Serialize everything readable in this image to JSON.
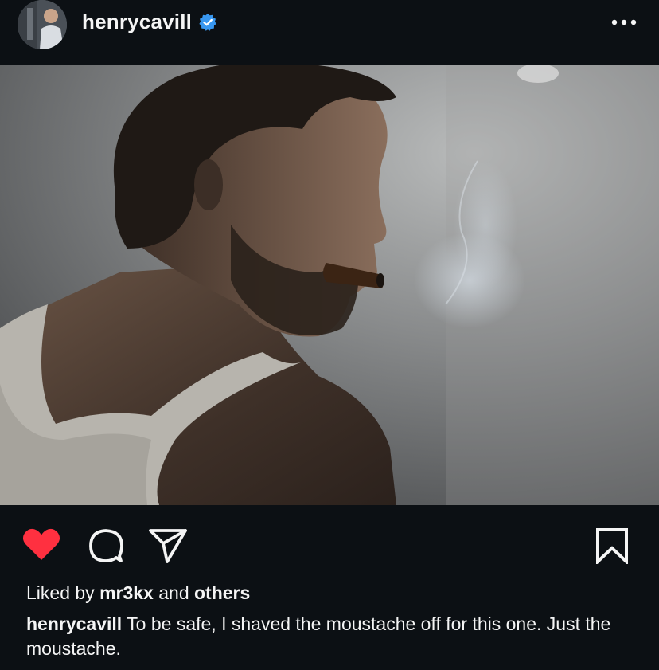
{
  "post": {
    "username": "henrycavill",
    "verified": true,
    "more_icon": "more-horizontal-icon",
    "photo_alt": "Man in a white tank top smoking a cigar in a smoky room"
  },
  "actions": {
    "like_icon": "heart-filled-icon",
    "comment_icon": "comment-icon",
    "share_icon": "send-icon",
    "save_icon": "bookmark-icon",
    "liked_state": true,
    "like_color": "#ff3040"
  },
  "likes": {
    "prefix": "Liked by",
    "user": "mr3kx",
    "joiner": "and",
    "others": "others"
  },
  "caption": {
    "username": "henrycavill",
    "text": "To be safe, I shaved the moustache off for this one. Just the moustache."
  },
  "colors": {
    "background": "#0c1014",
    "text": "#f5f5f5",
    "verified_blue": "#3897f0"
  }
}
